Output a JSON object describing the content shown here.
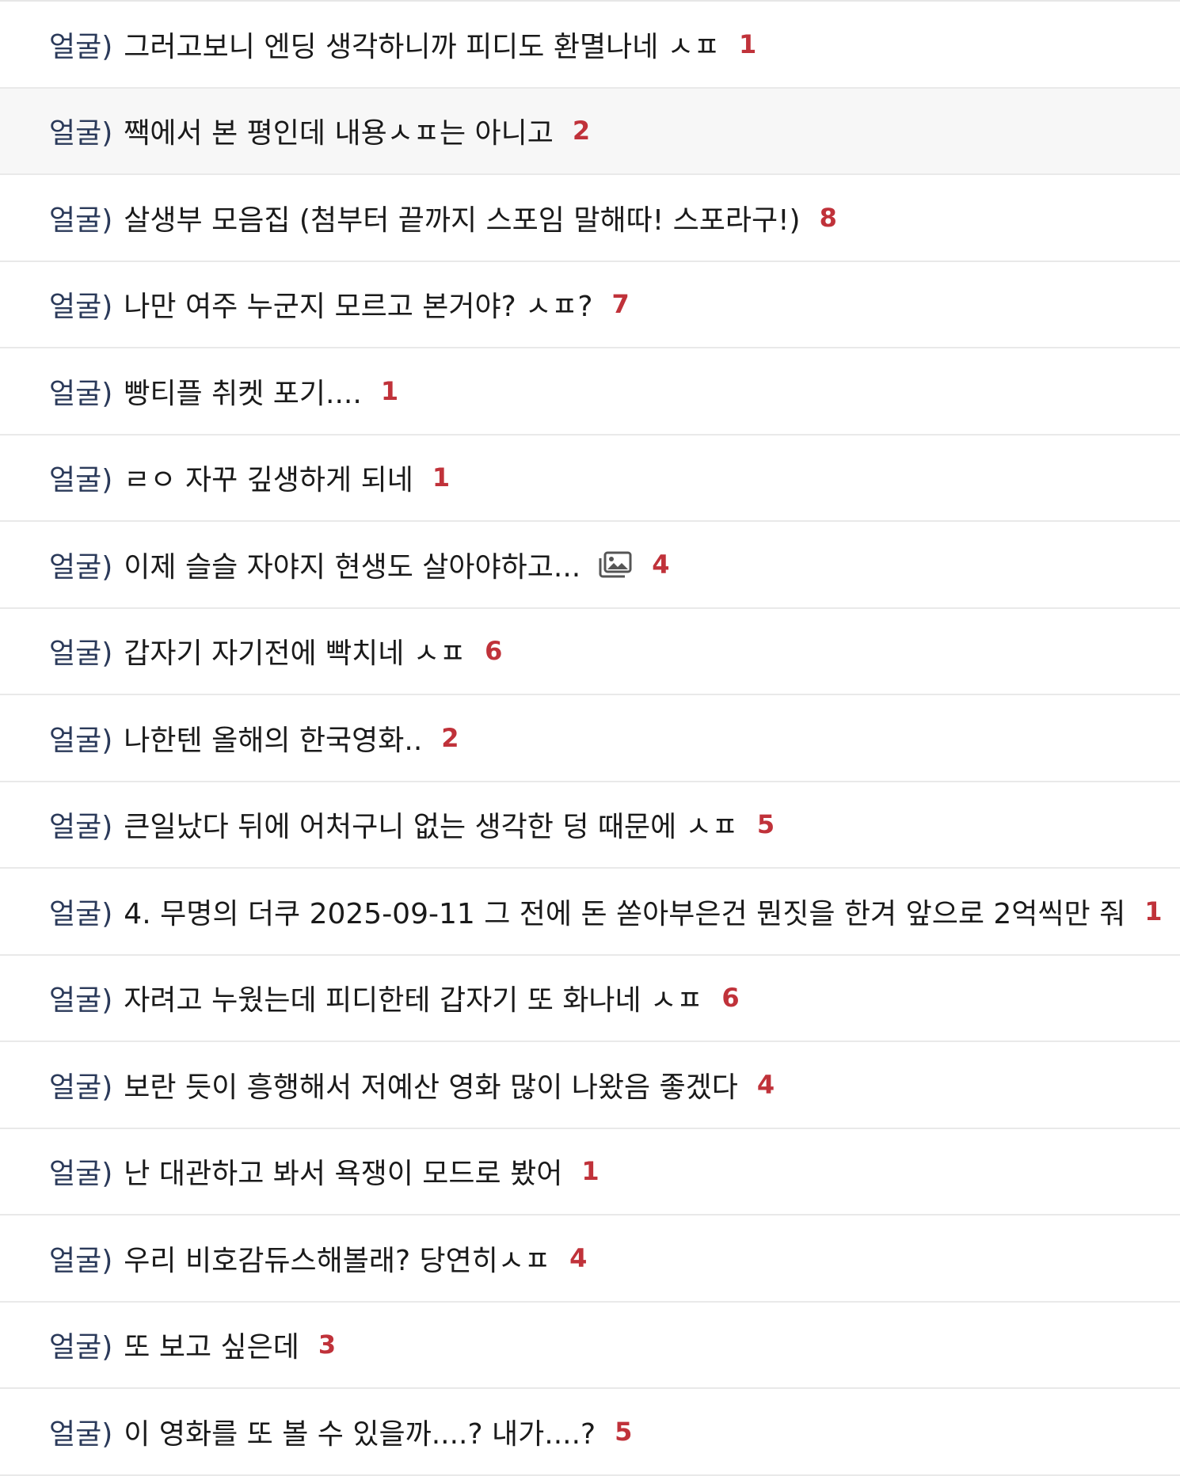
{
  "colors": {
    "category": "#2b3a5a",
    "title": "#1a1a1a",
    "comment_count": "#c0323a",
    "divider": "#e9e9e9",
    "hover_row": "#f7f7f7"
  },
  "posts": [
    {
      "category": "얼굴)",
      "title": "그러고보니 엔딩 생각하니까 피디도 환멸나네 ㅅㅍ",
      "comments": "1",
      "has_image": false
    },
    {
      "category": "얼굴)",
      "title": "짹에서 본 평인데 내용ㅅㅍ는 아니고",
      "comments": "2",
      "has_image": false
    },
    {
      "category": "얼굴)",
      "title": "살생부 모음집 (첨부터 끝까지 스포임 말해따! 스포라구!)",
      "comments": "8",
      "has_image": false
    },
    {
      "category": "얼굴)",
      "title": "나만 여주 누군지 모르고 본거야? ㅅㅍ?",
      "comments": "7",
      "has_image": false
    },
    {
      "category": "얼굴)",
      "title": "빵티플 취켓 포기....",
      "comments": "1",
      "has_image": false
    },
    {
      "category": "얼굴)",
      "title": "ㄹㅇ 자꾸 깊생하게 되네",
      "comments": "1",
      "has_image": false
    },
    {
      "category": "얼굴)",
      "title": "이제 슬슬 자야지 현생도 살아야하고...",
      "comments": "4",
      "has_image": true,
      "image_icon": "image-gallery-icon"
    },
    {
      "category": "얼굴)",
      "title": "갑자기 자기전에 빡치네 ㅅㅍ",
      "comments": "6",
      "has_image": false
    },
    {
      "category": "얼굴)",
      "title": "나한텐 올해의 한국영화..",
      "comments": "2",
      "has_image": false
    },
    {
      "category": "얼굴)",
      "title": "큰일났다 뒤에 어처구니 없는 생각한 덩 때문에 ㅅㅍ",
      "comments": "5",
      "has_image": false
    },
    {
      "category": "얼굴)",
      "title": "4. 무명의 더쿠 2025-09-11 그 전에 돈 쏟아부은건 뭔짓을 한겨 앞으로 2억씩만 줘",
      "comments": "1",
      "has_image": false
    },
    {
      "category": "얼굴)",
      "title": "자려고 누웠는데 피디한테 갑자기 또 화나네 ㅅㅍ",
      "comments": "6",
      "has_image": false
    },
    {
      "category": "얼굴)",
      "title": "보란 듯이 흥행해서 저예산 영화 많이 나왔음 좋겠다",
      "comments": "4",
      "has_image": false
    },
    {
      "category": "얼굴)",
      "title": "난 대관하고 봐서 욕쟁이 모드로 봤어",
      "comments": "1",
      "has_image": false
    },
    {
      "category": "얼굴)",
      "title": "우리 비호감듀스해볼래? 당연히ㅅㅍ",
      "comments": "4",
      "has_image": false
    },
    {
      "category": "얼굴)",
      "title": "또 보고 싶은데",
      "comments": "3",
      "has_image": false
    },
    {
      "category": "얼굴)",
      "title": "이 영화를 또 볼 수 있을까....? 내가....?",
      "comments": "5",
      "has_image": false
    }
  ]
}
